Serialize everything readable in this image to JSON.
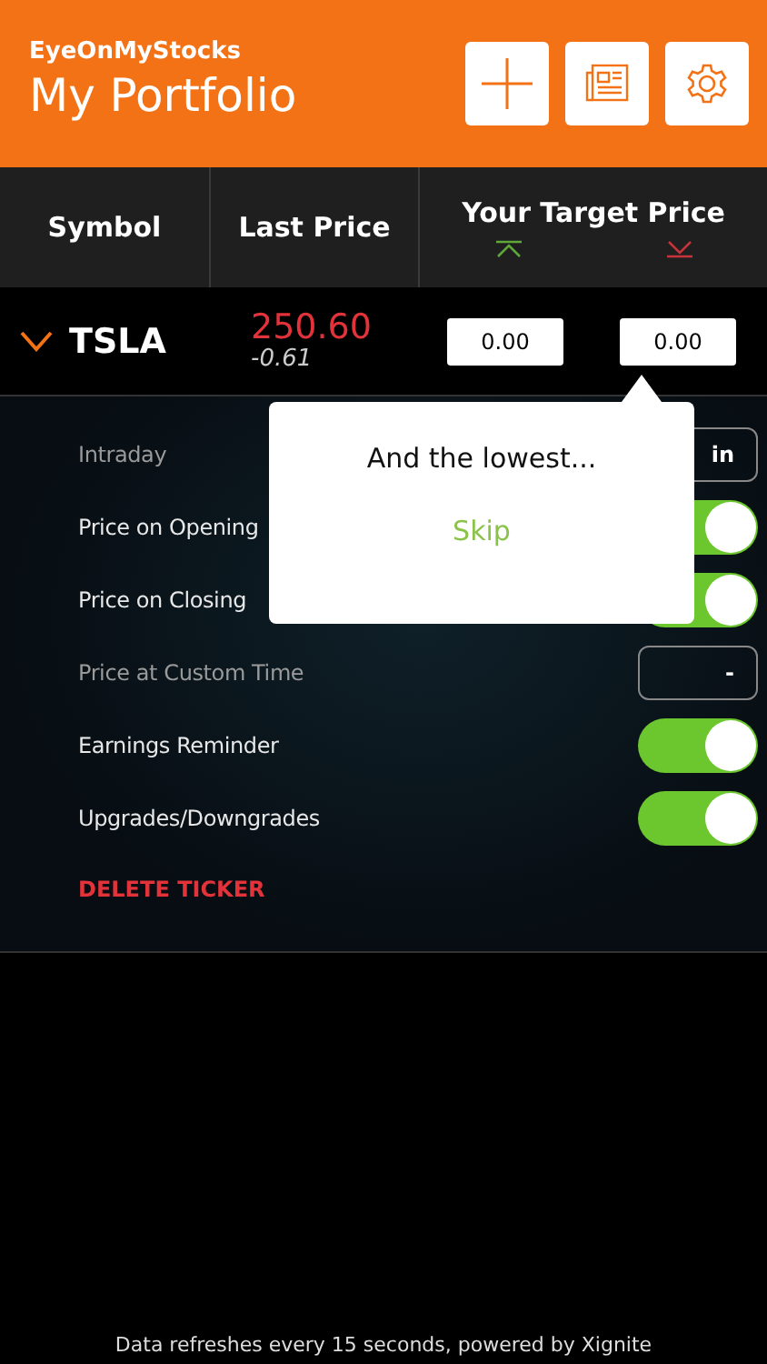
{
  "header": {
    "app_name": "EyeOnMyStocks",
    "title": "My Portfolio"
  },
  "columns": [
    {
      "label": "Symbol"
    },
    {
      "label": "Last Price"
    },
    {
      "label": "Your Target Price"
    }
  ],
  "ticker": {
    "symbol": "TSLA",
    "expanded": true,
    "price": "250.60",
    "change": "-0.61",
    "target_high": "0.00",
    "target_low": "0.00"
  },
  "settings": [
    {
      "kind": "button",
      "label": "Intraday",
      "disabled": true,
      "value": "in"
    },
    {
      "kind": "toggle",
      "label": "Price on Opening",
      "disabled": false,
      "on": true
    },
    {
      "kind": "toggle",
      "label": "Price on Closing",
      "disabled": false,
      "on": true
    },
    {
      "kind": "button",
      "label": "Price at Custom Time",
      "disabled": true,
      "value": "-"
    },
    {
      "kind": "toggle",
      "label": "Earnings Reminder",
      "disabled": false,
      "on": true
    },
    {
      "kind": "toggle",
      "label": "Upgrades/Downgrades",
      "disabled": false,
      "on": true
    }
  ],
  "delete_label": "DELETE TICKER",
  "popover": {
    "message": "And the lowest...",
    "action": "Skip"
  },
  "footer": "Data refreshes every 15 seconds, powered by Xignite"
}
